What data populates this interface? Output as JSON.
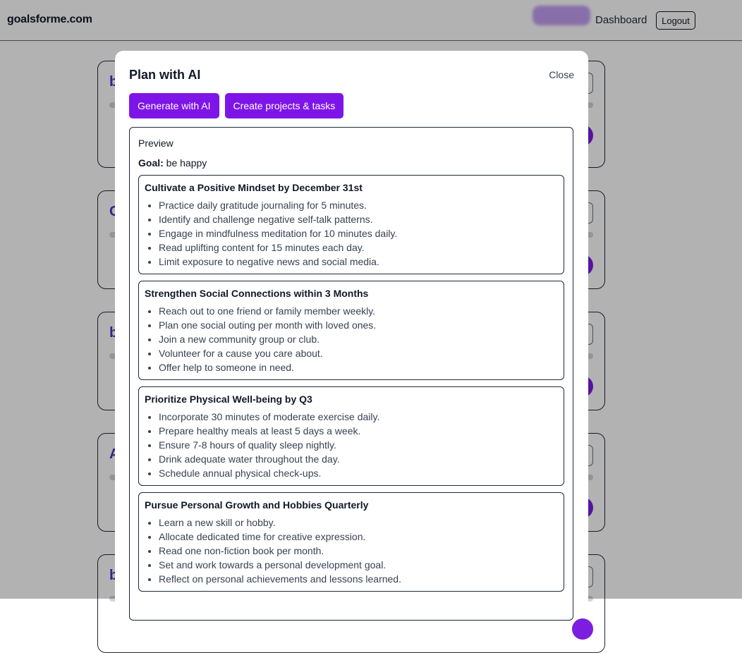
{
  "header": {
    "brand": "goalsforme.com",
    "nav_dashboard": "Dashboard",
    "logout_label": "Logout"
  },
  "background_goals": [
    {
      "initial": "b"
    },
    {
      "initial": "C"
    },
    {
      "initial": "b"
    },
    {
      "initial": "A"
    },
    {
      "initial": "b"
    }
  ],
  "modal": {
    "title": "Plan with AI",
    "close_label": "Close",
    "generate_label": "Generate with AI",
    "create_label": "Create projects & tasks",
    "preview_label": "Preview",
    "goal_key": "Goal:",
    "goal_value": "be happy",
    "projects": [
      {
        "title": "Cultivate a Positive Mindset by December 31st",
        "tasks": [
          "Practice daily gratitude journaling for 5 minutes.",
          "Identify and challenge negative self-talk patterns.",
          "Engage in mindfulness meditation for 10 minutes daily.",
          "Read uplifting content for 15 minutes each day.",
          "Limit exposure to negative news and social media."
        ]
      },
      {
        "title": "Strengthen Social Connections within 3 Months",
        "tasks": [
          "Reach out to one friend or family member weekly.",
          "Plan one social outing per month with loved ones.",
          "Join a new community group or club.",
          "Volunteer for a cause you care about.",
          "Offer help to someone in need."
        ]
      },
      {
        "title": "Prioritize Physical Well-being by Q3",
        "tasks": [
          "Incorporate 30 minutes of moderate exercise daily.",
          "Prepare healthy meals at least 5 days a week.",
          "Ensure 7-8 hours of quality sleep nightly.",
          "Drink adequate water throughout the day.",
          "Schedule annual physical check-ups."
        ]
      },
      {
        "title": "Pursue Personal Growth and Hobbies Quarterly",
        "tasks": [
          "Learn a new skill or hobby.",
          "Allocate dedicated time for creative expression.",
          "Read one non-fiction book per month.",
          "Set and work towards a personal development goal.",
          "Reflect on personal achievements and lessons learned."
        ]
      }
    ]
  },
  "colors": {
    "accent": "#7e15e8",
    "goal_title": "#4338ca",
    "overlay": "rgba(0,0,0,0.3)"
  }
}
